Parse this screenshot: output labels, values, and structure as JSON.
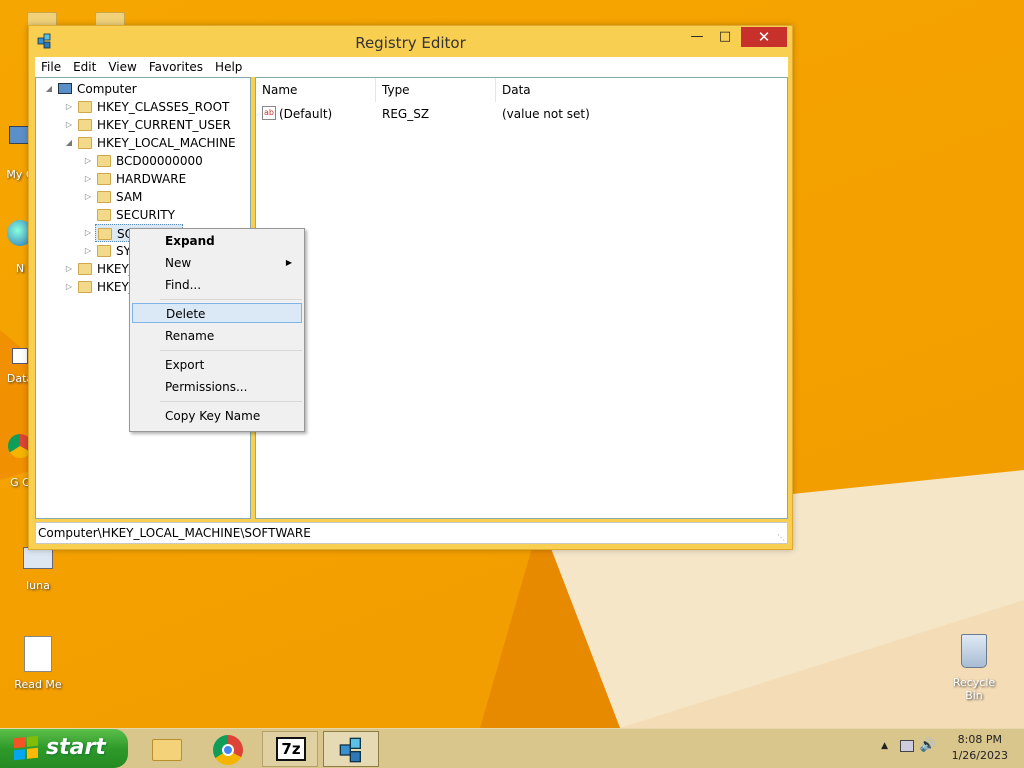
{
  "desktop": {
    "icons": [
      {
        "label": "My C"
      },
      {
        "label": "N"
      },
      {
        "label": "Data"
      },
      {
        "label": "G C"
      },
      {
        "label": "luna"
      },
      {
        "label": "Read Me"
      },
      {
        "label": "Recycle Bin"
      }
    ]
  },
  "window": {
    "title": "Registry Editor",
    "minimize": "—",
    "maximize": "□",
    "close": "✕"
  },
  "menubar": [
    "File",
    "Edit",
    "View",
    "Favorites",
    "Help"
  ],
  "tree": {
    "root": "Computer",
    "items": [
      "HKEY_CLASSES_ROOT",
      "HKEY_CURRENT_USER",
      "HKEY_LOCAL_MACHINE",
      "BCD00000000",
      "HARDWARE",
      "SAM",
      "SECURITY",
      "SO",
      "SY",
      "HKEY_",
      "HKEY_"
    ]
  },
  "list": {
    "headers": [
      "Name",
      "Type",
      "Data"
    ],
    "rows": [
      {
        "name": "(Default)",
        "type": "REG_SZ",
        "data": "(value not set)"
      }
    ]
  },
  "context_menu": {
    "items": [
      "Expand",
      "New",
      "Find...",
      "Delete",
      "Rename",
      "Export",
      "Permissions...",
      "Copy Key Name"
    ]
  },
  "status_bar": "Computer\\HKEY_LOCAL_MACHINE\\SOFTWARE",
  "taskbar": {
    "start": "start",
    "time": "8:08 PM",
    "date": "1/26/2023",
    "sevenzip": "7z"
  }
}
